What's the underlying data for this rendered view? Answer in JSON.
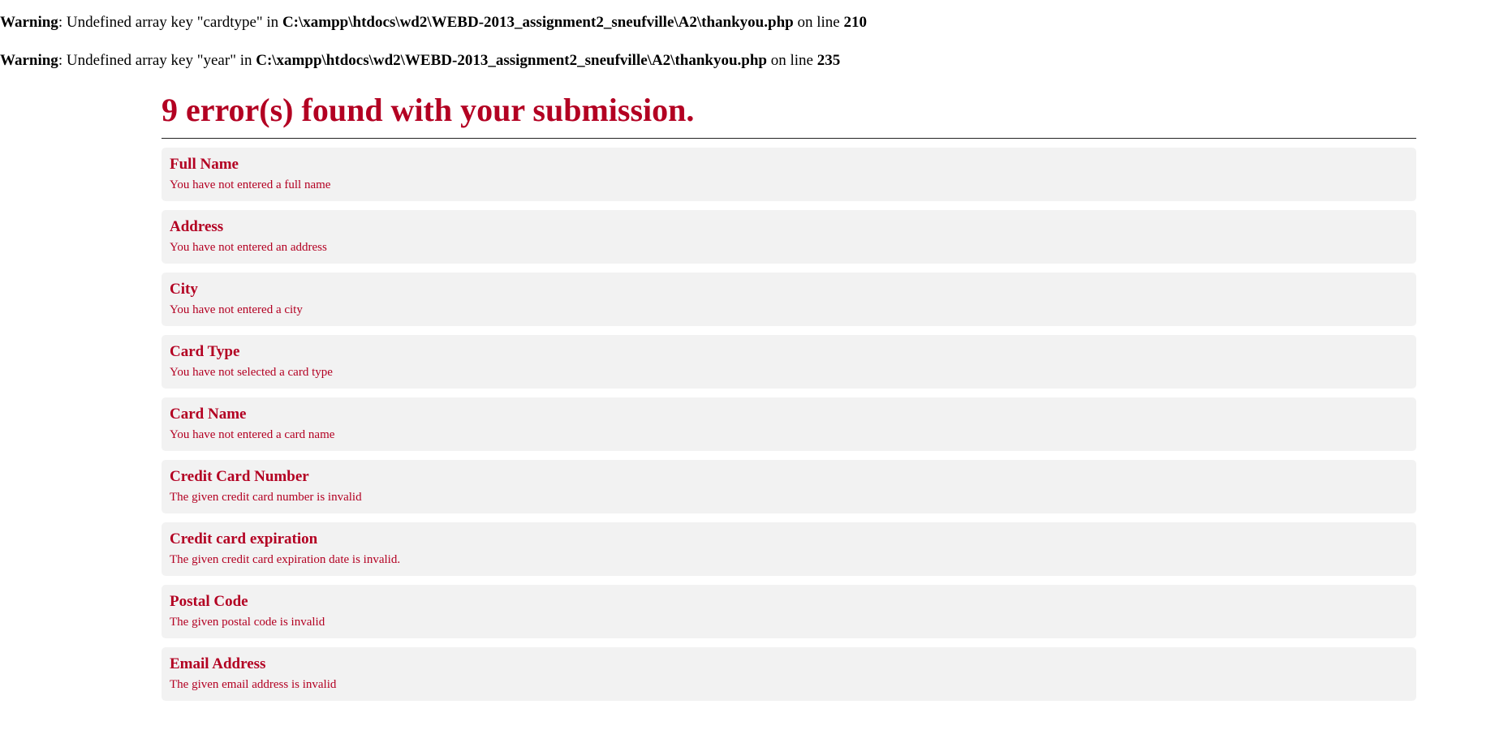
{
  "warnings": [
    {
      "label": "Warning",
      "message": ": Undefined array key \"cardtype\" in ",
      "path": "C:\\xampp\\htdocs\\wd2\\WEBD-2013_assignment2_sneufville\\A2\\thankyou.php",
      "on_line": " on line ",
      "line": "210"
    },
    {
      "label": "Warning",
      "message": ": Undefined array key \"year\" in ",
      "path": "C:\\xampp\\htdocs\\wd2\\WEBD-2013_assignment2_sneufville\\A2\\thankyou.php",
      "on_line": " on line ",
      "line": "235"
    }
  ],
  "errors_heading": "9 error(s) found with your submission.",
  "errors": [
    {
      "title": "Full Name",
      "message": "You have not entered a full name"
    },
    {
      "title": "Address",
      "message": "You have not entered an address"
    },
    {
      "title": "City",
      "message": "You have not entered a city"
    },
    {
      "title": "Card Type",
      "message": "You have not selected a card type"
    },
    {
      "title": "Card Name",
      "message": "You have not entered a card name"
    },
    {
      "title": "Credit Card Number",
      "message": "The given credit card number is invalid"
    },
    {
      "title": "Credit card expiration",
      "message": "The given credit card expiration date is invalid."
    },
    {
      "title": "Postal Code",
      "message": "The given postal code is invalid"
    },
    {
      "title": "Email Address",
      "message": "The given email address is invalid"
    }
  ],
  "colors": {
    "error_red": "#b30022",
    "card_bg": "#f2f2f2"
  }
}
